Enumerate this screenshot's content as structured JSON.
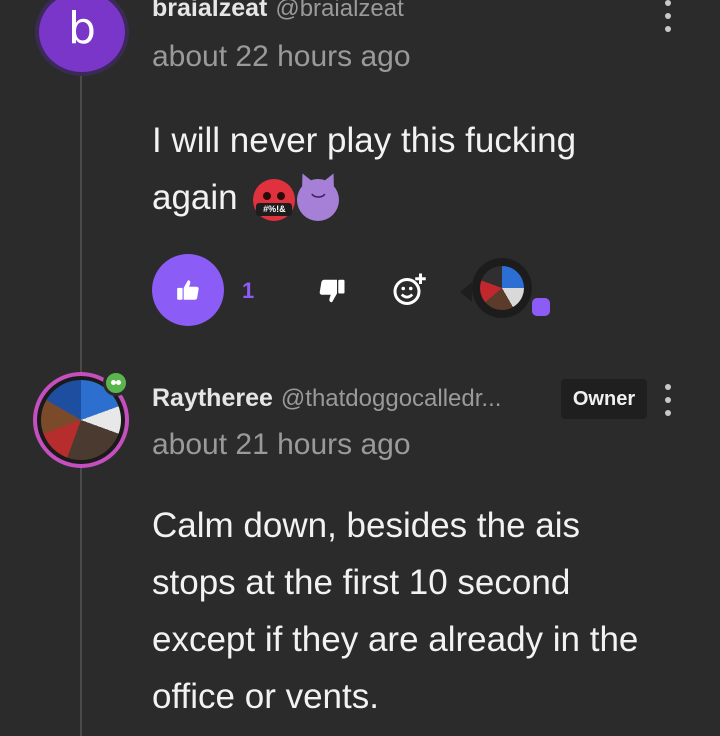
{
  "comments": [
    {
      "avatar_letter": "b",
      "username": "braialzeat",
      "handle": "@braialzeat",
      "time": "about 22 hours ago",
      "body_line1": "I will never play this fucking",
      "body_line2": "again",
      "emoji_censor_text": "#%!&",
      "like_count": "1"
    },
    {
      "username": "Raytheree",
      "handle": "@thatdoggocalledr...",
      "badge": "Owner",
      "time": "about 21 hours ago",
      "body": "Calm down, besides the ais stops at the first 10 second except if they are already in the office or vents."
    }
  ],
  "colors": {
    "background": "#2b2b2b",
    "accent_purple": "#8b5cf6",
    "muted_text": "#9a9a9a"
  },
  "icons": [
    "thumbs-up-icon",
    "thumbs-down-icon",
    "add-reaction-icon",
    "kebab-menu-icon"
  ]
}
